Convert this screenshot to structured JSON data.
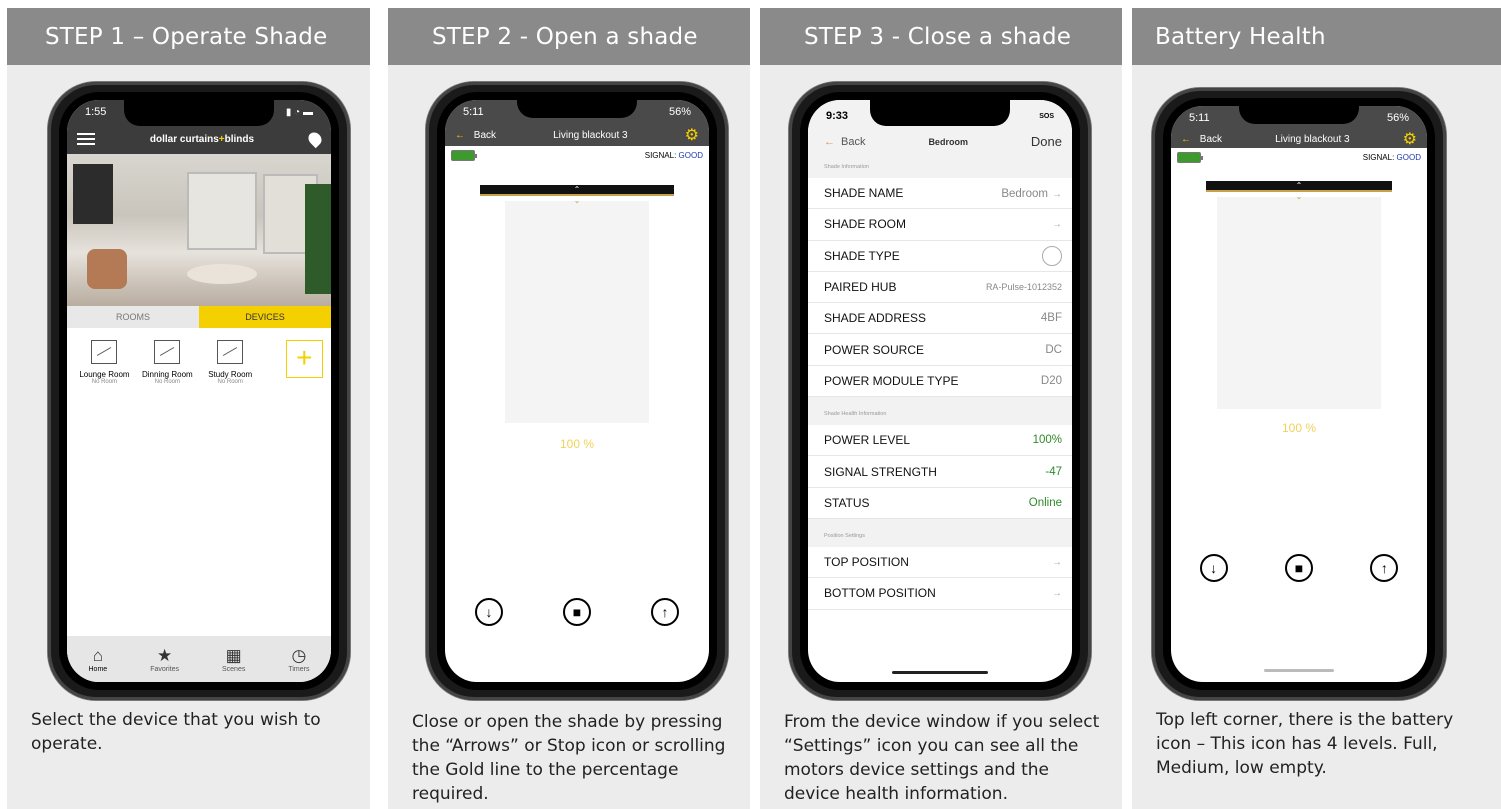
{
  "cards": [
    {
      "title": "STEP 1 – Operate Shade",
      "description": "Select the device that you wish to operate.",
      "phone": {
        "status_time": "1:55",
        "brand_left": "dollar curtains",
        "brand_sep": "+",
        "brand_right": "blinds",
        "tabs": [
          "ROOMS",
          "DEVICES"
        ],
        "devices": [
          {
            "name": "Lounge Room",
            "room": "No Room"
          },
          {
            "name": "Dinning Room",
            "room": "No Room"
          },
          {
            "name": "Study Room",
            "room": "No Room"
          }
        ],
        "add_label": "+",
        "nav": [
          {
            "label": "Home",
            "icon": "home-icon"
          },
          {
            "label": "Favorites",
            "icon": "star-icon"
          },
          {
            "label": "Scenes",
            "icon": "film-icon"
          },
          {
            "label": "Timers",
            "icon": "clock-icon"
          }
        ]
      }
    },
    {
      "title": "STEP 2 - Open a shade",
      "description": "Close or open the shade by pressing the “Arrows” or Stop icon or scrolling the Gold line to the percentage required.",
      "phone": {
        "status_time": "5:11",
        "status_right": "56%",
        "back_label": "Back",
        "shade_name": "Living blackout 3",
        "signal_label": "SIGNAL:",
        "signal_value": "GOOD",
        "percent": "100 %",
        "battery_level": 1.0
      }
    },
    {
      "title": "STEP 3 - Close a shade",
      "description": "From the device window if you select “Settings” icon you can see all the motors device settings and the device health information.",
      "phone": {
        "status_time": "9:33",
        "status_right": "SOS",
        "back_label": "Back",
        "title": "Bedroom",
        "done_label": "Done",
        "sections": {
          "shade_info": "Shade Information",
          "health_info": "Shade Health Information",
          "position": "Position Settings"
        },
        "info_rows": [
          {
            "label": "SHADE NAME",
            "value": "Bedroom"
          },
          {
            "label": "SHADE ROOM",
            "value": ""
          },
          {
            "label": "SHADE TYPE",
            "value": ""
          },
          {
            "label": "PAIRED HUB",
            "value": "RA-Pulse-1012352"
          },
          {
            "label": "SHADE ADDRESS",
            "value": "4BF"
          },
          {
            "label": "POWER SOURCE",
            "value": "DC"
          },
          {
            "label": "POWER MODULE TYPE",
            "value": "D20"
          }
        ],
        "health_rows": [
          {
            "label": "POWER LEVEL",
            "value": "100%"
          },
          {
            "label": "SIGNAL STRENGTH",
            "value": "-47"
          },
          {
            "label": "STATUS",
            "value": "Online"
          }
        ],
        "position_rows": [
          {
            "label": "TOP POSITION"
          },
          {
            "label": "BOTTOM POSITION"
          }
        ]
      }
    },
    {
      "title": "Battery Health",
      "description": "Top left corner, there is the battery icon – This icon has 4 levels. Full, Medium, low empty.",
      "phone": {
        "status_time": "5:11",
        "status_right": "56%",
        "back_label": "Back",
        "shade_name": "Living blackout 3",
        "signal_label": "SIGNAL:",
        "signal_value": "GOOD",
        "percent": "100 %",
        "battery_level": 1.0
      }
    }
  ],
  "colors": {
    "header_bg": "#8a8a8a",
    "card_bg": "#ececec",
    "accent_gold": "#f5d000",
    "good_green": "#2f8a2a",
    "signal_blue": "#1d39b0"
  }
}
